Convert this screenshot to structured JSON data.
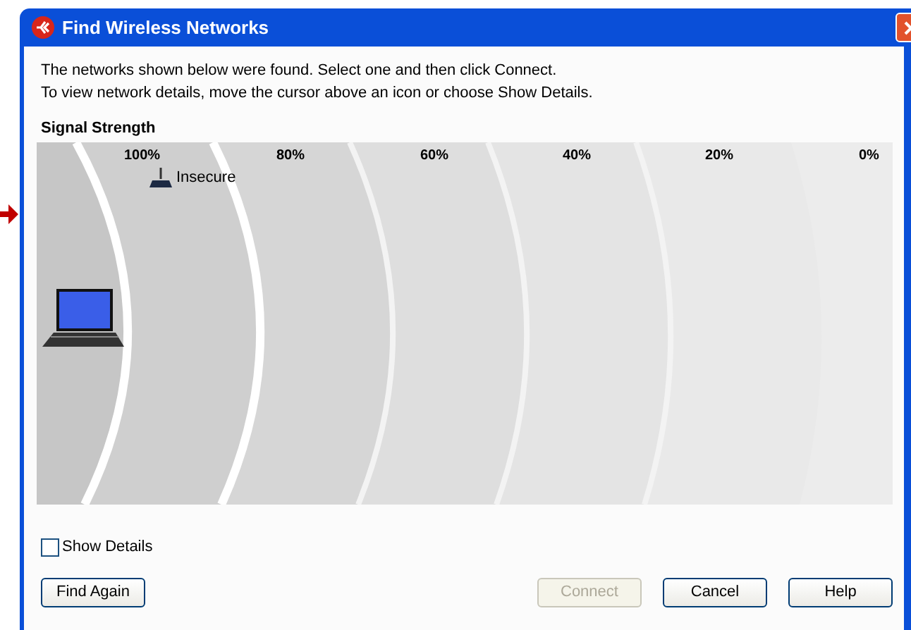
{
  "window": {
    "title": "Find Wireless Networks"
  },
  "instructions": [
    "The networks shown below were found. Select one and then click Connect.",
    "To view network details, move the cursor above an icon or choose Show Details."
  ],
  "signal_strength": {
    "heading": "Signal Strength",
    "levels": [
      "100%",
      "80%",
      "60%",
      "40%",
      "20%",
      "0%"
    ],
    "networks": [
      {
        "name": "Insecure"
      }
    ]
  },
  "show_details": {
    "label": "Show Details",
    "checked": false
  },
  "buttons": [
    {
      "label": "Find Again",
      "disabled": false
    },
    {
      "label": "Connect",
      "disabled": true
    },
    {
      "label": "Cancel",
      "disabled": false
    },
    {
      "label": "Help",
      "disabled": false
    }
  ]
}
